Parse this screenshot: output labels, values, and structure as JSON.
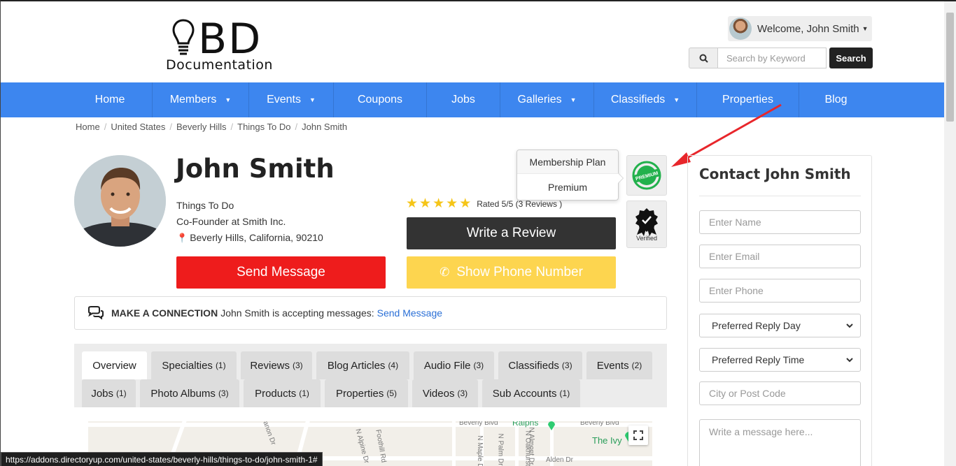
{
  "header": {
    "logo_main": "BD",
    "logo_sub": "Documentation",
    "welcome": "Welcome, John Smith",
    "search_placeholder": "Search by Keyword",
    "search_button": "Search"
  },
  "nav": [
    {
      "label": "Home",
      "dropdown": false
    },
    {
      "label": "Members",
      "dropdown": true
    },
    {
      "label": "Events",
      "dropdown": true
    },
    {
      "label": "Coupons",
      "dropdown": false
    },
    {
      "label": "Jobs",
      "dropdown": false
    },
    {
      "label": "Galleries",
      "dropdown": true
    },
    {
      "label": "Classifieds",
      "dropdown": true
    },
    {
      "label": "Properties",
      "dropdown": false
    },
    {
      "label": "Blog",
      "dropdown": false
    }
  ],
  "breadcrumb": [
    "Home",
    "United States",
    "Beverly Hills",
    "Things To Do",
    "John Smith"
  ],
  "profile": {
    "name": "John Smith",
    "category": "Things To Do",
    "title": "Co-Founder at Smith Inc.",
    "location": "Beverly Hills, California, 90210",
    "rating_text": "Rated 5/5 (3 Reviews )",
    "stars": 5
  },
  "buttons": {
    "write_review": "Write a Review",
    "show_phone": "Show Phone Number",
    "send_message": "Send Message"
  },
  "popover": {
    "title": "Membership Plan",
    "value": "Premium"
  },
  "badges": {
    "premium": "PREMIUM",
    "verified": "Verified"
  },
  "connection": {
    "label": "MAKE A CONNECTION",
    "text": "John Smith is accepting messages:",
    "link": "Send Message"
  },
  "tabs": [
    {
      "label": "Overview",
      "count": ""
    },
    {
      "label": "Specialties",
      "count": "(1)"
    },
    {
      "label": "Reviews",
      "count": "(3)"
    },
    {
      "label": "Blog Articles",
      "count": "(4)"
    },
    {
      "label": "Audio File",
      "count": "(3)"
    },
    {
      "label": "Classifieds",
      "count": "(3)"
    },
    {
      "label": "Events",
      "count": "(2)"
    },
    {
      "label": "Jobs",
      "count": "(1)"
    },
    {
      "label": "Photo Albums",
      "count": "(3)"
    },
    {
      "label": "Products",
      "count": "(1)"
    },
    {
      "label": "Properties",
      "count": "(5)"
    },
    {
      "label": "Videos",
      "count": "(3)"
    },
    {
      "label": "Sub Accounts",
      "count": "(1)"
    }
  ],
  "map": {
    "labels": [
      "Beverly Blvd",
      "Beverly Blvd",
      "Ralphs",
      "The Ivy",
      "Alden Dr",
      "Canon Dr",
      "N Alpine Dr",
      "Foothill Rd",
      "N Maple Dr",
      "N Palm Dr",
      "N Oakhurst Dr",
      "N Almont Dr"
    ]
  },
  "status_url": "https://addons.directoryup.com/united-states/beverly-hills/things-to-do/john-smith-1#",
  "contact": {
    "title": "Contact John Smith",
    "name_placeholder": "Enter Name",
    "email_placeholder": "Enter Email",
    "phone_placeholder": "Enter Phone",
    "reply_day": "Preferred Reply Day",
    "reply_time": "Preferred Reply Time",
    "city_placeholder": "City or Post Code",
    "message_placeholder": "Write a message here..."
  },
  "colors": {
    "nav": "#3d86ef",
    "send_message": "#ee1c1c",
    "show_phone": "#fdd54f",
    "write_review": "#333333",
    "star": "#f5c518",
    "annotation_arrow": "#e8262b"
  }
}
